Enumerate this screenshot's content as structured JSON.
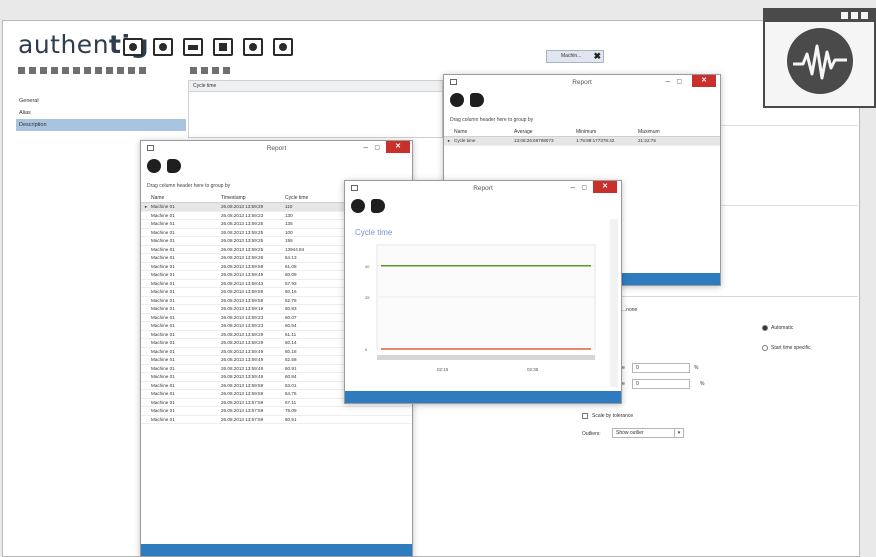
{
  "brand": {
    "text_light": "authen",
    "text_bold": "tig"
  },
  "mini_tab": {
    "label": "Machin...",
    "close": "✖"
  },
  "nav": {
    "items": [
      "General",
      "Alias",
      "Description"
    ],
    "selected_index": 2
  },
  "list_box": {
    "header": "Cycle time"
  },
  "report_left": {
    "title": "Report",
    "drag_hint": "Drag column header here to group by",
    "columns": [
      "Name",
      "Timestamp",
      "Cycle time"
    ],
    "rows": [
      [
        "Machine 01",
        "26.08.2013 13:59:29",
        "110"
      ],
      [
        "Machine 01",
        "26.08.2013 13:59:23",
        "130"
      ],
      [
        "Machine 01",
        "26.08.2013 13:59:25",
        "135"
      ],
      [
        "Machine 01",
        "26.08.2013 13:59:25",
        "100"
      ],
      [
        "Machine 01",
        "26.08.2013 13:59:25",
        "195"
      ],
      [
        "Machine 01",
        "26.08.2013 13:59:25",
        "13944.84"
      ],
      [
        "Machine 01",
        "26.08.2013 13:59:28",
        "64.13"
      ],
      [
        "Machine 01",
        "26.08.2013 13:59:59",
        "61.08"
      ],
      [
        "Machine 01",
        "26.08.2013 13:59:49",
        "60.09"
      ],
      [
        "Machine 01",
        "26.08.2013 13:59:43",
        "57.93"
      ],
      [
        "Machine 01",
        "26.08.2013 13:59:59",
        "60.16"
      ],
      [
        "Machine 01",
        "26.08.2013 13:59:59",
        "52.78"
      ],
      [
        "Machine 01",
        "26.08.2013 13:59:19",
        "60.83"
      ],
      [
        "Machine 01",
        "26.08.2013 13:59:23",
        "60.07"
      ],
      [
        "Machine 01",
        "26.08.2013 13:59:23",
        "60.54"
      ],
      [
        "Machine 01",
        "26.08.2013 13:59:29",
        "61.11"
      ],
      [
        "Machine 01",
        "26.08.2013 13:59:29",
        "60.14"
      ],
      [
        "Machine 01",
        "26.08.2013 13:59:49",
        "60.18"
      ],
      [
        "Machine 01",
        "26.08.2013 13:59:49",
        "62.58"
      ],
      [
        "Machine 01",
        "26.08.2013 13:59:49",
        "60.91"
      ],
      [
        "Machine 01",
        "26.08.2013 13:59:49",
        "60.84"
      ],
      [
        "Machine 01",
        "26.08.2013 13:59:59",
        "63.01"
      ],
      [
        "Machine 01",
        "26.08.2013 13:59:59",
        "64.75"
      ],
      [
        "Machine 01",
        "26.08.2013 13:57:59",
        "67.11"
      ],
      [
        "Machine 01",
        "26.08.2013 13:57:59",
        "76.09"
      ],
      [
        "Machine 01",
        "26.08.2013 13:57:59",
        "60.51"
      ]
    ]
  },
  "report_right": {
    "title": "Report",
    "drag_hint": "Drag column header here to group by",
    "columns": [
      "Name",
      "Average",
      "Minimum",
      "Maximum"
    ],
    "rows": [
      [
        "Cycle time",
        "13:08:26:66798073",
        "1:79:89:177378:42",
        "21:22:75"
      ]
    ]
  },
  "report_chart": {
    "title": "Report",
    "chart_title": "Cycle time",
    "x_labels": [
      "02:15",
      "02:35"
    ]
  },
  "chart_data": {
    "type": "line",
    "title": "Cycle time",
    "ylim": [
      0,
      50
    ],
    "yticks": [
      0,
      25,
      40
    ],
    "x_ticks": [
      "02:15",
      "02:35"
    ],
    "series": [
      {
        "values": [
          40,
          40,
          40,
          40,
          40
        ],
        "color": "#5a9a2a"
      },
      {
        "values": [
          0,
          0,
          0,
          0,
          0
        ],
        "color": "#e0603a"
      }
    ],
    "grid": true
  },
  "right_panel": {
    "heading": "...none",
    "radio1": "Automatic",
    "radio2": "Start time specific",
    "field1_label": "e",
    "field1_value": "0",
    "field1_unit": "%",
    "field2_label": "e",
    "field2_value": "0",
    "field2_unit": "%",
    "check_label": "Scale by tolerance",
    "outlier_label": "Outliers:",
    "outlier_value": "Show outlier"
  },
  "colors": {
    "accent_blue": "#2f7bbf",
    "close_red": "#c9302c",
    "selection": "#a9c4df",
    "brand": "#2e3d4f"
  },
  "corner_logo": {
    "icon": "waveform-icon"
  }
}
